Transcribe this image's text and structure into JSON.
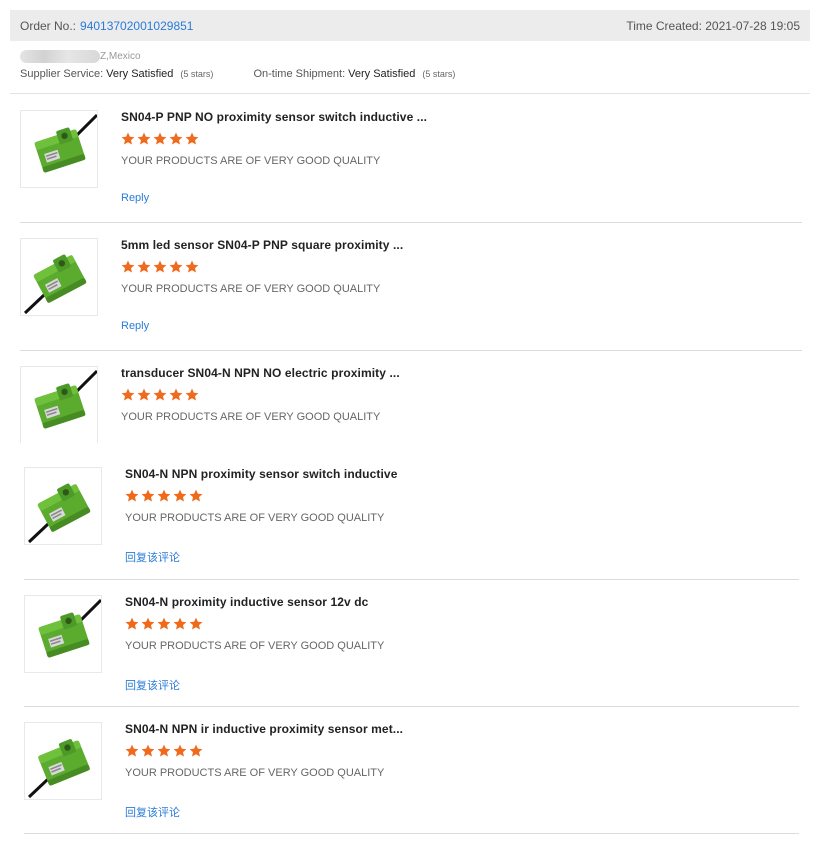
{
  "header": {
    "order_label": "Order No.:",
    "order_number": "94013702001029851",
    "time_created": "Time Created: 2021-07-28 19:05"
  },
  "buyer": {
    "location": "Z,Mexico"
  },
  "ratings": {
    "supplier_label": "Supplier Service:",
    "supplier_value": "Very Satisfied",
    "supplier_stars": "(5 stars)",
    "shipment_label": "On-time Shipment:",
    "shipment_value": "Very Satisfied",
    "shipment_stars": "(5 stars)"
  },
  "colors": {
    "accent_link": "#2a7bd8",
    "star": "#f06a1c",
    "sensor_green": "#5bab2f"
  },
  "items": [
    {
      "title": "SN04-P PNP NO proximity sensor switch inductive ...",
      "stars": 5,
      "review": "YOUR PRODUCTS ARE OF VERY GOOD QUALITY",
      "reply": "Reply",
      "image": "green-proximity-sensor"
    },
    {
      "title": "5mm led sensor SN04-P PNP square proximity ...",
      "stars": 5,
      "review": "YOUR PRODUCTS ARE OF VERY GOOD QUALITY",
      "reply": "Reply",
      "image": "green-proximity-sensor"
    },
    {
      "title": "transducer SN04-N NPN NO electric proximity ...",
      "stars": 5,
      "review": "YOUR PRODUCTS ARE OF VERY GOOD QUALITY",
      "reply": "",
      "image": "green-proximity-sensor"
    },
    {
      "title": "SN04-N NPN proximity sensor switch inductive",
      "stars": 5,
      "review": "YOUR PRODUCTS ARE OF VERY GOOD QUALITY",
      "reply": "回复该评论",
      "image": "green-proximity-sensor"
    },
    {
      "title": "SN04-N proximity inductive sensor 12v dc",
      "stars": 5,
      "review": "YOUR PRODUCTS ARE OF VERY GOOD QUALITY",
      "reply": "回复该评论",
      "image": "green-proximity-sensor"
    },
    {
      "title": "SN04-N NPN ir inductive proximity sensor met...",
      "stars": 5,
      "review": "YOUR PRODUCTS ARE OF VERY GOOD QUALITY",
      "reply": "回复该评论",
      "image": "green-proximity-sensor"
    }
  ]
}
